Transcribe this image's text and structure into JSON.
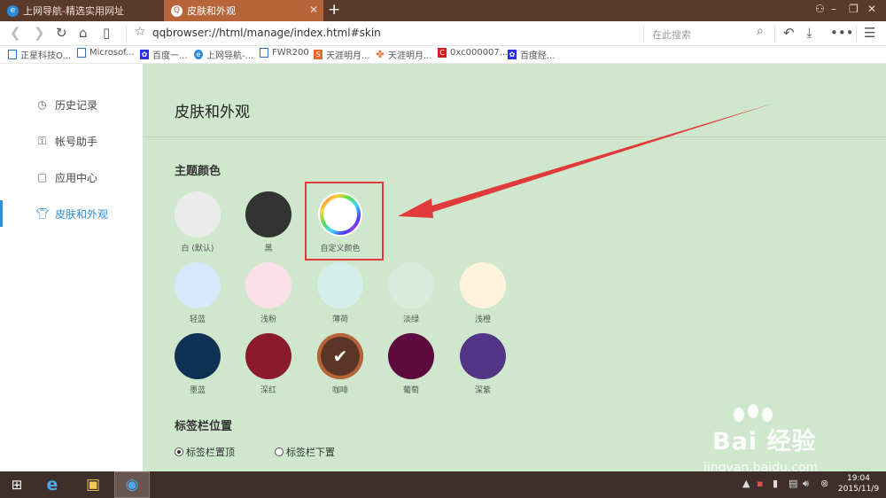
{
  "tabs": [
    {
      "label": "上网导航-精选实用网址",
      "icon": "e-browser-icon"
    },
    {
      "label": "皮肤和外观",
      "icon": "qq-browser-icon"
    }
  ],
  "address": {
    "url": "qqbrowser://html/manage/index.html#skin",
    "search_placeholder": "在此搜索"
  },
  "bookmarks": [
    {
      "label": "正星科技O...",
      "color": "#2b6fc4"
    },
    {
      "label": "Microsof...",
      "color": "#2b6fc4"
    },
    {
      "label": "百度一...",
      "color": "#2932e1"
    },
    {
      "label": "上网导航-...",
      "color": "#2b8be0"
    },
    {
      "label": "FWR200",
      "color": "#2b6fc4"
    },
    {
      "label": "天涯明月...",
      "color": "#e86a2a"
    },
    {
      "label": "天涯明月...",
      "color": "#e86a2a"
    },
    {
      "label": "0xc000007...",
      "color": "#d02020"
    },
    {
      "label": "百度经...",
      "color": "#2932e1"
    }
  ],
  "sidebar": {
    "items": [
      {
        "label": "历史记录",
        "icon": "clock-icon"
      },
      {
        "label": "帐号助手",
        "icon": "key-icon"
      },
      {
        "label": "应用中心",
        "icon": "bag-icon"
      },
      {
        "label": "皮肤和外观",
        "icon": "shirt-icon",
        "active": true
      }
    ]
  },
  "main": {
    "title": "皮肤和外观",
    "theme_section": "主题颜色",
    "colors": [
      {
        "label": "白 (默认)",
        "color": "#ebebeb"
      },
      {
        "label": "黑",
        "color": "#333333"
      },
      {
        "label": "自定义颜色",
        "color": "custom-ring"
      },
      {
        "label": "轻蓝",
        "color": "#d6e8fb"
      },
      {
        "label": "浅粉",
        "color": "#fbe0ea"
      },
      {
        "label": "薄荷",
        "color": "#d4eeea"
      },
      {
        "label": "淡绿",
        "color": "#d6ecdc"
      },
      {
        "label": "浅橙",
        "color": "#fdf3dd"
      },
      {
        "label": "墨蓝",
        "color": "#0f3154"
      },
      {
        "label": "深红",
        "color": "#8b1b2a"
      },
      {
        "label": "咖啡",
        "color": "#5b3526",
        "selected": true
      },
      {
        "label": "葡萄",
        "color": "#5d0a3f"
      },
      {
        "label": "深紫",
        "color": "#523685"
      }
    ],
    "tab_position_section": "标签栏位置",
    "tab_position_options": [
      {
        "label": "标签栏置顶",
        "checked": true
      },
      {
        "label": "标签栏下置",
        "checked": false
      }
    ]
  },
  "taskbar": {
    "time": "19:04",
    "date": "2015/11/9"
  },
  "watermark": {
    "brand": "Bai 经验",
    "sub": "jingyan.baidu.com"
  },
  "annotation": {
    "box_color": "#e03a3a",
    "arrow_color": "#e03a3a"
  }
}
